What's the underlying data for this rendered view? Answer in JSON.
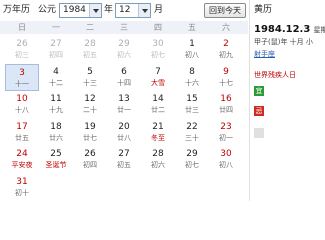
{
  "toolbar": {
    "app_title": "万年历",
    "calendar_label": "公元",
    "year_value": "1984",
    "year_unit": "年",
    "month_value": "12",
    "month_unit": "月",
    "today_button": "回到今天"
  },
  "weekdays": [
    "日",
    "一",
    "二",
    "三",
    "四",
    "五",
    "六"
  ],
  "weeks": [
    [
      {
        "day": "26",
        "lunar": "初三",
        "other": true
      },
      {
        "day": "27",
        "lunar": "初四",
        "other": true
      },
      {
        "day": "28",
        "lunar": "初五",
        "other": true
      },
      {
        "day": "29",
        "lunar": "初六",
        "other": true
      },
      {
        "day": "30",
        "lunar": "初七",
        "other": true
      },
      {
        "day": "1",
        "lunar": "初八"
      },
      {
        "day": "2",
        "lunar": "初九"
      }
    ],
    [
      {
        "day": "3",
        "lunar": "十一",
        "today": true
      },
      {
        "day": "4",
        "lunar": "十二"
      },
      {
        "day": "5",
        "lunar": "十三"
      },
      {
        "day": "6",
        "lunar": "十四"
      },
      {
        "day": "7",
        "lunar": "大雪",
        "festival": true
      },
      {
        "day": "8",
        "lunar": "十六"
      },
      {
        "day": "9",
        "lunar": "十七"
      }
    ],
    [
      {
        "day": "10",
        "lunar": "十八"
      },
      {
        "day": "11",
        "lunar": "十九"
      },
      {
        "day": "12",
        "lunar": "二十"
      },
      {
        "day": "13",
        "lunar": "廿一"
      },
      {
        "day": "14",
        "lunar": "廿二"
      },
      {
        "day": "15",
        "lunar": "廿三"
      },
      {
        "day": "16",
        "lunar": "廿四"
      }
    ],
    [
      {
        "day": "17",
        "lunar": "廿五"
      },
      {
        "day": "18",
        "lunar": "廿六"
      },
      {
        "day": "19",
        "lunar": "廿七"
      },
      {
        "day": "20",
        "lunar": "廿八"
      },
      {
        "day": "21",
        "lunar": "冬至",
        "festival": true
      },
      {
        "day": "22",
        "lunar": "三十"
      },
      {
        "day": "23",
        "lunar": "初一"
      }
    ],
    [
      {
        "day": "24",
        "lunar": "平安夜",
        "festival": true
      },
      {
        "day": "25",
        "lunar": "圣诞节",
        "festival": true
      },
      {
        "day": "26",
        "lunar": "初四"
      },
      {
        "day": "27",
        "lunar": "初五"
      },
      {
        "day": "28",
        "lunar": "初六"
      },
      {
        "day": "29",
        "lunar": "初七"
      },
      {
        "day": "30",
        "lunar": "初八"
      }
    ],
    [
      {
        "day": "31",
        "lunar": "初十"
      }
    ]
  ],
  "side": {
    "header": "黄历",
    "date": "1984.12.3",
    "weekday": "星期一",
    "ganzhi": "甲子(鼠)年 十月 小",
    "link": "射手座",
    "festival": "世界残疾人日",
    "yi_label": "宜",
    "ji_label": "忌"
  },
  "colors": {
    "weekend": "#c00000",
    "header_bg": "#eef2f8",
    "today_bg": "#dbe7f7",
    "link": "#2a5db0"
  }
}
